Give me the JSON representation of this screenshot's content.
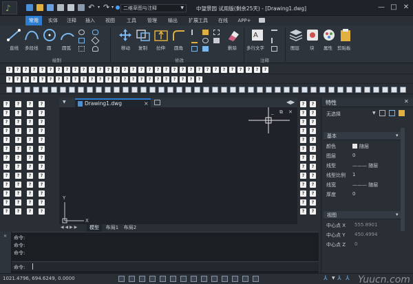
{
  "title_bar": {
    "workspace": "二维草图与注释",
    "title": "中望景园 试用版(剩余25天) - [Drawing1.dwg]"
  },
  "menu_tabs": [
    "常用",
    "实体",
    "注释",
    "插入",
    "视图",
    "工具",
    "管理",
    "输出",
    "扩展工具",
    "在线",
    "APP+"
  ],
  "ribbon": {
    "draw_tools": [
      "直线",
      "多段线",
      "圆",
      "圆弧"
    ],
    "modify_tools": [
      "移动",
      "复制",
      "拉伸",
      "圆角",
      "删除"
    ],
    "annot_tools": [
      "多行文字"
    ],
    "other_tools": [
      "图层",
      "块",
      "属性",
      "剪贴板"
    ],
    "groups": [
      "绘制",
      "修改",
      "注释"
    ]
  },
  "doc_tab": "Drawing1.dwg",
  "layout_tabs": [
    "模型",
    "布局1",
    "布局2"
  ],
  "command_lines": [
    "命令:",
    "命令:",
    "命令:"
  ],
  "command_prompt": "命令:",
  "status_coords": "1021.4796, 694.6249, 0.0000",
  "props": {
    "title": "特性",
    "selection": "无选择",
    "sections": {
      "basic": "基本",
      "view": "视图"
    },
    "basic_rows": [
      {
        "label": "颜色",
        "value": "随层"
      },
      {
        "label": "图层",
        "value": "0"
      },
      {
        "label": "线型",
        "value": "——— 随层"
      },
      {
        "label": "线型比例",
        "value": "1"
      },
      {
        "label": "线宽",
        "value": "——— 随层"
      },
      {
        "label": "厚度",
        "value": "0"
      }
    ],
    "view_rows": [
      {
        "label": "中心点 X",
        "value": "555.8901"
      },
      {
        "label": "中心点 Y",
        "value": "450.4994"
      },
      {
        "label": "中心点 Z",
        "value": "0"
      }
    ]
  },
  "axis": {
    "x": "X",
    "y": "Y"
  },
  "watermark": "Yuucn.com"
}
